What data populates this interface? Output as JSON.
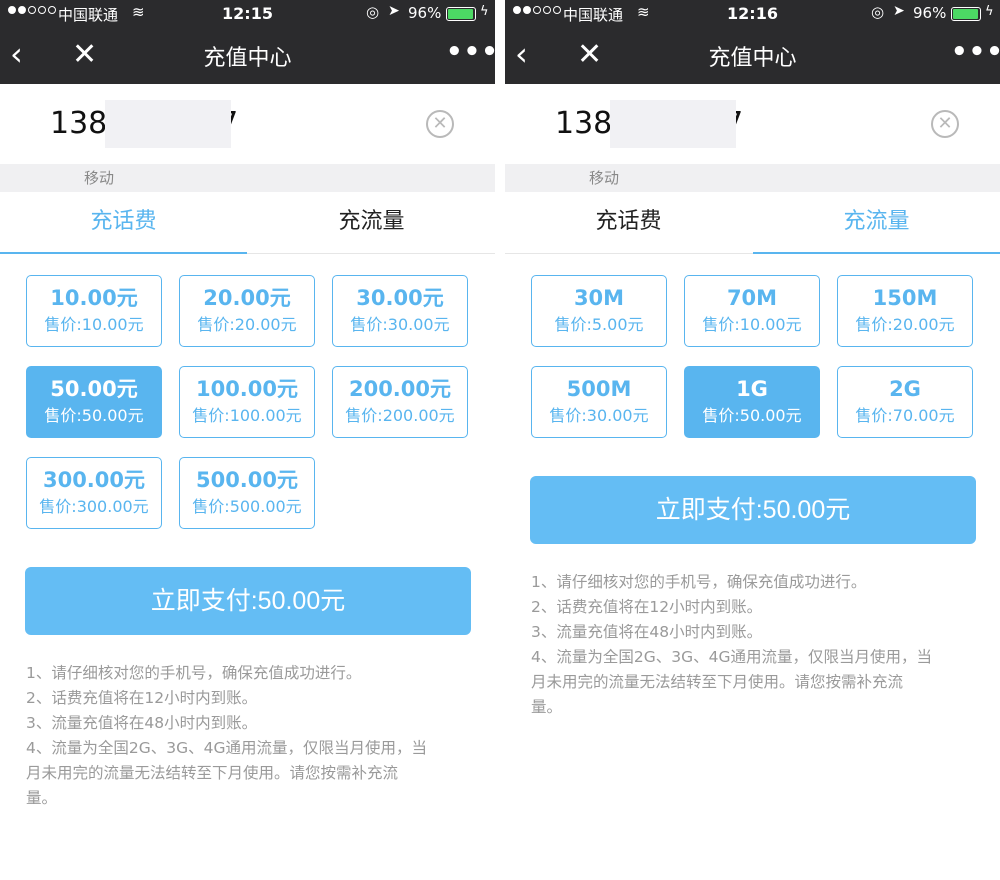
{
  "status": {
    "carrier": "中国联通",
    "time_left": "12:15",
    "time_right": "12:16",
    "battery_pct": "96%",
    "battery_level": 0.96
  },
  "nav": {
    "back_icon": "‹",
    "close_icon": "✕",
    "title": "充值中心",
    "more_icon": "•••"
  },
  "phone": {
    "prefix": "138",
    "suffix": "57",
    "carrier_label": "移动",
    "clear_icon": "✕"
  },
  "tabs": {
    "call": "充话费",
    "data": "充流量"
  },
  "left_options": [
    {
      "amount": "10.00元",
      "price": "售价:10.00元",
      "selected": false
    },
    {
      "amount": "20.00元",
      "price": "售价:20.00元",
      "selected": false
    },
    {
      "amount": "30.00元",
      "price": "售价:30.00元",
      "selected": false
    },
    {
      "amount": "50.00元",
      "price": "售价:50.00元",
      "selected": true
    },
    {
      "amount": "100.00元",
      "price": "售价:100.00元",
      "selected": false
    },
    {
      "amount": "200.00元",
      "price": "售价:200.00元",
      "selected": false
    },
    {
      "amount": "300.00元",
      "price": "售价:300.00元",
      "selected": false
    },
    {
      "amount": "500.00元",
      "price": "售价:500.00元",
      "selected": false
    }
  ],
  "right_options": [
    {
      "amount": "30M",
      "price": "售价:5.00元",
      "selected": false
    },
    {
      "amount": "70M",
      "price": "售价:10.00元",
      "selected": false
    },
    {
      "amount": "150M",
      "price": "售价:20.00元",
      "selected": false
    },
    {
      "amount": "500M",
      "price": "售价:30.00元",
      "selected": false
    },
    {
      "amount": "1G",
      "price": "售价:50.00元",
      "selected": true
    },
    {
      "amount": "2G",
      "price": "售价:70.00元",
      "selected": false
    }
  ],
  "pay_label": "立即支付:50.00元",
  "notes": [
    "1、请仔细核对您的手机号，确保充值成功进行。",
    "2、话费充值将在12小时内到账。",
    "3、流量充值将在48小时内到账。",
    "4、流量为全国2G、3G、4G通用流量，仅限当月使用，当",
    "月未用完的流量无法结转至下月使用。请您按需补充流",
    "量。"
  ],
  "colors": {
    "accent": "#59b5ef",
    "pay_button": "#64bdf4",
    "topbar": "#2b2b2d"
  }
}
